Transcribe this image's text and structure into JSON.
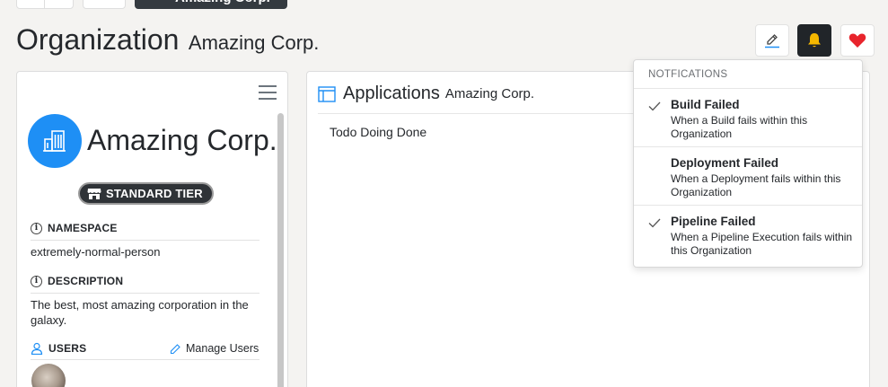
{
  "top_tabs": {
    "active_label": "Amazing Corp."
  },
  "header": {
    "title": "Organization",
    "subtitle": "Amazing Corp."
  },
  "org_card": {
    "name": "Amazing Corp.",
    "tier": "STANDARD TIER",
    "namespace_label": "NAMESPACE",
    "namespace_value": "extremely-normal-person",
    "description_label": "DESCRIPTION",
    "description_value": "The best, most amazing corporation in the galaxy.",
    "users_label": "USERS",
    "manage_users_label": "Manage Users"
  },
  "applications": {
    "title": "Applications",
    "subtitle": "Amazing Corp.",
    "body": "Todo Doing Done"
  },
  "notifications": {
    "header": "NOTFICATIONS",
    "items": [
      {
        "title": "Build Failed",
        "description": "When a Build fails within this Organization",
        "checked": true
      },
      {
        "title": "Deployment Failed",
        "description": "When a Deployment fails within this Organization",
        "checked": false
      },
      {
        "title": "Pipeline Failed",
        "description": "When a Pipeline Execution fails within this Organization",
        "checked": true
      }
    ]
  },
  "colors": {
    "background": "#f4f3f1",
    "accent_blue": "#1e8ff5",
    "bell_bg": "#212529",
    "bell_icon": "#f5b800",
    "heart": "#e8242c",
    "edit_underline": "#1e8ff5"
  },
  "icons": {
    "edit": "pencil-icon",
    "bell": "bell-icon",
    "heart": "heart-icon",
    "menu": "hamburger-icon",
    "org": "building-icon",
    "tier": "storefront-icon",
    "info": "info-icon",
    "users": "user-icon",
    "apps": "window-icon",
    "check": "checkmark-icon"
  }
}
